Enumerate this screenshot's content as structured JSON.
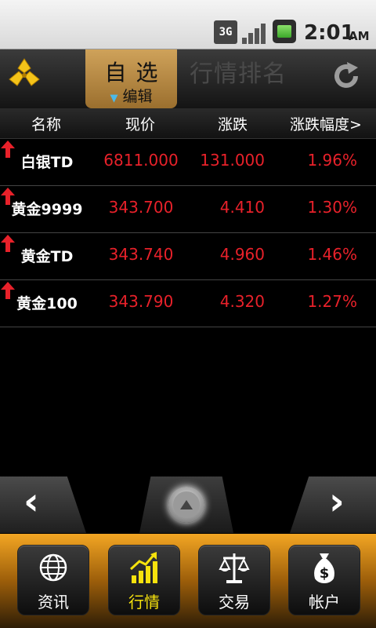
{
  "status_bar": {
    "network": "3G",
    "time": "2:01",
    "ampm": "AM"
  },
  "header": {
    "active_tab": "自选",
    "active_tab_sub": "编辑",
    "other_tab": "行情排名"
  },
  "columns": [
    "名称",
    "现价",
    "涨跌",
    "涨跌幅度>"
  ],
  "rows": [
    {
      "name": "白银TD",
      "price": "6811.000",
      "change": "131.000",
      "percent": "1.96%"
    },
    {
      "name": "黄金9999",
      "price": "343.700",
      "change": "4.410",
      "percent": "1.30%"
    },
    {
      "name": "黄金TD",
      "price": "343.740",
      "change": "4.960",
      "percent": "1.46%"
    },
    {
      "name": "黄金100",
      "price": "343.790",
      "change": "4.320",
      "percent": "1.27%"
    }
  ],
  "tabbar": [
    {
      "label": "资讯",
      "icon": "globe-icon"
    },
    {
      "label": "行情",
      "icon": "chart-up-icon",
      "active": true
    },
    {
      "label": "交易",
      "icon": "scale-icon"
    },
    {
      "label": "帐户",
      "icon": "money-bag-icon"
    }
  ],
  "colors": {
    "up": "#e8212a",
    "accent": "#f3a623",
    "active_label": "#f6e20d"
  }
}
